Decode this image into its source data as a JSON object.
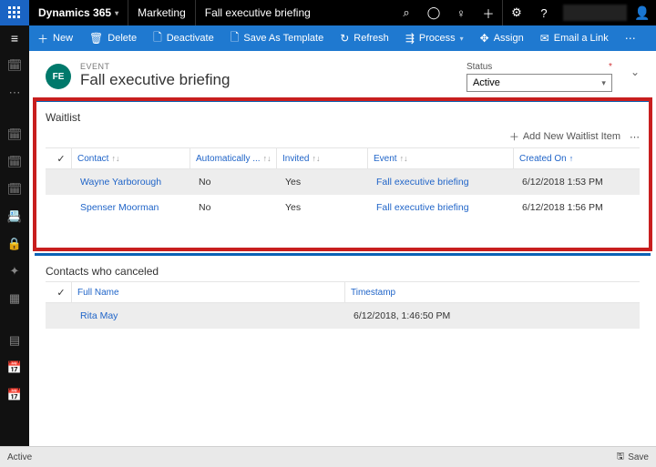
{
  "topbar": {
    "product": "Dynamics 365",
    "module": "Marketing",
    "context": "Fall executive briefing"
  },
  "cmdbar": {
    "new": "New",
    "delete": "Delete",
    "deactivate": "Deactivate",
    "save_as_template": "Save As Template",
    "refresh": "Refresh",
    "process": "Process",
    "assign": "Assign",
    "email_link": "Email a Link"
  },
  "header": {
    "badge": "FE",
    "overline": "EVENT",
    "title": "Fall executive briefing",
    "status_label": "Status",
    "status_value": "Active"
  },
  "waitlist": {
    "title": "Waitlist",
    "add_label": "Add New Waitlist Item",
    "columns": {
      "contact": "Contact",
      "auto": "Automatically ...",
      "invited": "Invited",
      "event": "Event",
      "created": "Created On"
    },
    "rows": [
      {
        "contact": "Wayne Yarborough",
        "auto": "No",
        "invited": "Yes",
        "event": "Fall executive briefing",
        "created": "6/12/2018 1:53 PM"
      },
      {
        "contact": "Spenser Moorman",
        "auto": "No",
        "invited": "Yes",
        "event": "Fall executive briefing",
        "created": "6/12/2018 1:56 PM"
      }
    ]
  },
  "canceled": {
    "title": "Contacts who canceled",
    "columns": {
      "full_name": "Full Name",
      "timestamp": "Timestamp"
    },
    "rows": [
      {
        "full_name": "Rita May",
        "timestamp": "6/12/2018, 1:46:50 PM"
      }
    ]
  },
  "statusbar": {
    "left": "Active",
    "save": "Save"
  }
}
